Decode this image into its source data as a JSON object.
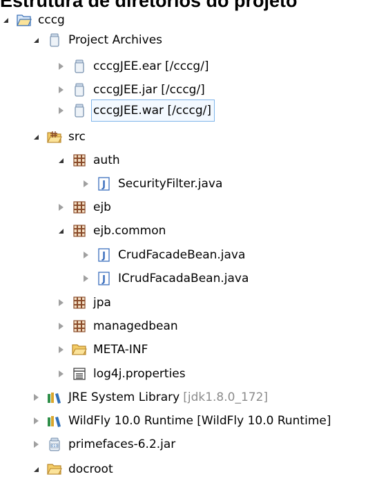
{
  "heading": "Estrutura de diretórios do projeto",
  "tree": {
    "root_label": "cccg",
    "project_archives": {
      "label": "Project Archives",
      "items": [
        "cccgJEE.ear [/cccg/]",
        "cccgJEE.jar [/cccg/]",
        "cccgJEE.war [/cccg/]"
      ]
    },
    "src": {
      "label": "src",
      "auth": {
        "label": "auth",
        "files": [
          "SecurityFilter.java"
        ]
      },
      "ejb": {
        "label": "ejb"
      },
      "ejb_common": {
        "label": "ejb.common",
        "files": [
          "CrudFacadeBean.java",
          "ICrudFacadaBean.java"
        ]
      },
      "jpa": {
        "label": "jpa"
      },
      "managedbean": {
        "label": "managedbean"
      },
      "meta_inf": {
        "label": "META-INF"
      },
      "log4j": {
        "label": "log4j.properties"
      }
    },
    "jre": {
      "label": "JRE System Library",
      "decoration": "[jdk1.8.0_172]"
    },
    "wildfly": {
      "label": "WildFly 10.0 Runtime [WildFly 10.0 Runtime]"
    },
    "primefaces": {
      "label": "primefaces-6.2.jar"
    },
    "docroot": {
      "label": "docroot"
    }
  },
  "colors": {
    "selection_border": "#7eb4ea",
    "decoration_text": "#8b8b8b",
    "package_icon": "#8a4b2a",
    "folder_icon": "#e7b94c",
    "java_icon": "#3a6ebd"
  },
  "icons": {
    "project": "project-folder-icon",
    "archives": "archive-jar-icon",
    "source_folder": "source-folder-icon",
    "package": "package-icon",
    "java_file": "java-file-icon",
    "folder": "folder-icon",
    "properties": "properties-file-icon",
    "library": "library-icon",
    "binary_jar": "binary-jar-icon"
  }
}
